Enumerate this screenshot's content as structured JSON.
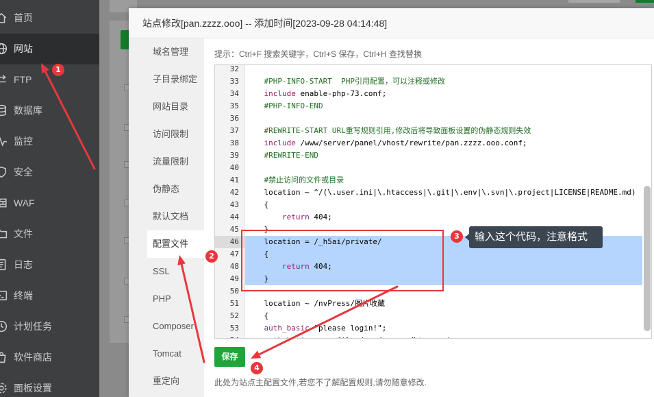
{
  "colors": {
    "accent": "#20a53a",
    "annotation_red": "#e8373c",
    "comment": "#236e24",
    "keyword": "#931a68",
    "selection": "#b5d5ff",
    "tooltip_bg": "#3c4651"
  },
  "sidebar": {
    "items": [
      {
        "label": "首页",
        "icon": "home-icon",
        "active": false
      },
      {
        "label": "网站",
        "icon": "globe-icon",
        "active": true
      },
      {
        "label": "FTP",
        "icon": "ftp-icon",
        "active": false
      },
      {
        "label": "数据库",
        "icon": "database-icon",
        "active": false
      },
      {
        "label": "监控",
        "icon": "monitor-icon",
        "active": false
      },
      {
        "label": "安全",
        "icon": "shield-icon",
        "active": false
      },
      {
        "label": "WAF",
        "icon": "waf-icon",
        "active": false
      },
      {
        "label": "文件",
        "icon": "folder-icon",
        "active": false
      },
      {
        "label": "日志",
        "icon": "log-icon",
        "active": false
      },
      {
        "label": "终端",
        "icon": "terminal-icon",
        "active": false
      },
      {
        "label": "计划任务",
        "icon": "clock-icon",
        "active": false
      },
      {
        "label": "软件商店",
        "icon": "store-icon",
        "active": false
      },
      {
        "label": "面板设置",
        "icon": "settings-icon",
        "active": false
      }
    ]
  },
  "dialog": {
    "title": "站点修改[pan.zzzz.ooo] -- 添加时间[2023-09-28 04:14:48]",
    "menu": [
      {
        "label": "域名管理",
        "active": false
      },
      {
        "label": "子目录绑定",
        "active": false
      },
      {
        "label": "网站目录",
        "active": false
      },
      {
        "label": "访问限制",
        "active": false
      },
      {
        "label": "流量限制",
        "active": false
      },
      {
        "label": "伪静态",
        "active": false
      },
      {
        "label": "默认文档",
        "active": false
      },
      {
        "label": "配置文件",
        "active": true
      },
      {
        "label": "SSL",
        "active": false
      },
      {
        "label": "PHP",
        "active": false
      },
      {
        "label": "Composer",
        "active": false
      },
      {
        "label": "Tomcat",
        "active": false
      },
      {
        "label": "重定向",
        "active": false
      }
    ],
    "hint": "提示：Ctrl+F 搜索关键字，Ctrl+S 保存，Ctrl+H 查找替换",
    "save_label": "保存",
    "footer_note": "此处为站点主配置文件,若您不了解配置规则,请勿随意修改."
  },
  "editor": {
    "lines": [
      {
        "num": "32",
        "tokens": []
      },
      {
        "num": "33",
        "tokens": [
          {
            "text": "    ",
            "kind": "plain"
          },
          {
            "text": "#PHP-INFO-START  PHP引用配置，可以注释或修改",
            "kind": "comment"
          }
        ]
      },
      {
        "num": "34",
        "tokens": [
          {
            "text": "    ",
            "kind": "plain"
          },
          {
            "text": "include",
            "kind": "keyword"
          },
          {
            "text": " enable-php-73.conf;",
            "kind": "plain"
          }
        ]
      },
      {
        "num": "35",
        "tokens": [
          {
            "text": "    ",
            "kind": "plain"
          },
          {
            "text": "#PHP-INFO-END",
            "kind": "comment"
          }
        ]
      },
      {
        "num": "36",
        "tokens": []
      },
      {
        "num": "37",
        "tokens": [
          {
            "text": "    ",
            "kind": "plain"
          },
          {
            "text": "#REWRITE-START URL重写规则引用,修改后将导致面板设置的伪静态规则失效",
            "kind": "comment"
          }
        ]
      },
      {
        "num": "38",
        "tokens": [
          {
            "text": "    ",
            "kind": "plain"
          },
          {
            "text": "include",
            "kind": "keyword"
          },
          {
            "text": " /www/server/panel/vhost/rewrite/pan.zzzz.ooo.conf;",
            "kind": "plain"
          }
        ]
      },
      {
        "num": "39",
        "tokens": [
          {
            "text": "    ",
            "kind": "plain"
          },
          {
            "text": "#REWRITE-END",
            "kind": "comment"
          }
        ]
      },
      {
        "num": "40",
        "tokens": []
      },
      {
        "num": "41",
        "tokens": [
          {
            "text": "    ",
            "kind": "plain"
          },
          {
            "text": "#禁止访问的文件或目录",
            "kind": "comment"
          }
        ]
      },
      {
        "num": "42",
        "tokens": [
          {
            "text": "    location ~ ^/(\\.user.ini|\\.htaccess|\\.git|\\.env|\\.svn|\\.project|LICENSE|README.md)",
            "kind": "plain"
          }
        ]
      },
      {
        "num": "43",
        "tokens": [
          {
            "text": "    {",
            "kind": "plain"
          }
        ]
      },
      {
        "num": "44",
        "tokens": [
          {
            "text": "        ",
            "kind": "plain"
          },
          {
            "text": "return",
            "kind": "keyword"
          },
          {
            "text": " 404;",
            "kind": "plain"
          }
        ]
      },
      {
        "num": "45",
        "tokens": [
          {
            "text": "    }",
            "kind": "plain"
          }
        ]
      },
      {
        "num": "46",
        "active": true,
        "selected": true,
        "tokens": [
          {
            "text": "    location = /_h5ai/private/",
            "kind": "plain"
          }
        ]
      },
      {
        "num": "47",
        "selected": true,
        "tokens": [
          {
            "text": "    {",
            "kind": "plain"
          }
        ]
      },
      {
        "num": "48",
        "selected": true,
        "tokens": [
          {
            "text": "        ",
            "kind": "plain"
          },
          {
            "text": "return",
            "kind": "keyword"
          },
          {
            "text": " 404;",
            "kind": "plain"
          }
        ]
      },
      {
        "num": "49",
        "selected": true,
        "tokens": [
          {
            "text": "    }",
            "kind": "plain"
          }
        ]
      },
      {
        "num": "50",
        "tokens": []
      },
      {
        "num": "51",
        "tokens": [
          {
            "text": "    location ~ /nvPress/图片收藏",
            "kind": "plain"
          }
        ]
      },
      {
        "num": "52",
        "tokens": [
          {
            "text": "    {",
            "kind": "plain"
          }
        ]
      },
      {
        "num": "53",
        "tokens": [
          {
            "text": "    ",
            "kind": "plain"
          },
          {
            "text": "auth_basic",
            "kind": "keyword"
          },
          {
            "text": " \"please login!\";",
            "kind": "plain"
          }
        ]
      },
      {
        "num": "54",
        "tokens": [
          {
            "text": "    ",
            "kind": "plain"
          },
          {
            "text": "auth_basic_user_file",
            "kind": "keyword"
          },
          {
            "text": " /www/server/htpasswd;",
            "kind": "plain"
          }
        ]
      }
    ]
  },
  "annotations": {
    "markers": [
      "1",
      "2",
      "3",
      "4"
    ],
    "tooltip": "输入这个代码，注意格式"
  }
}
